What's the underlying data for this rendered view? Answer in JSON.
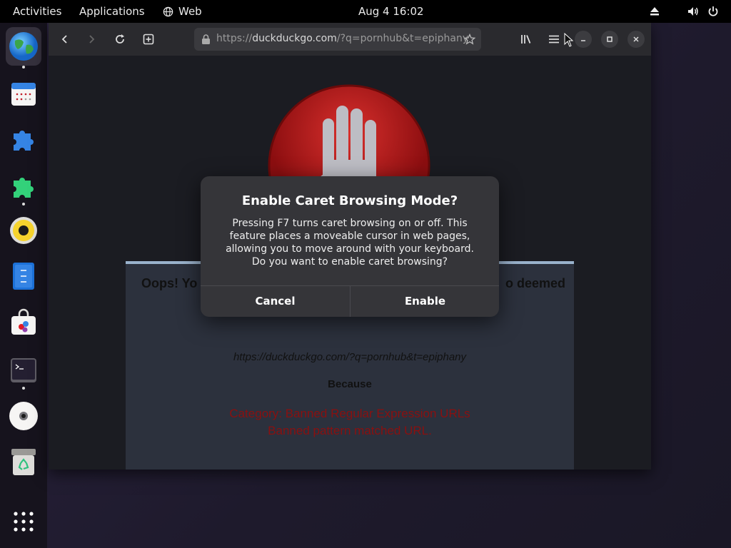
{
  "topbar": {
    "activities": "Activities",
    "applications": "Applications",
    "web": "Web",
    "clock": "Aug 4  16:02"
  },
  "dock": {
    "items": [
      {
        "name": "web-browser"
      },
      {
        "name": "calendar"
      },
      {
        "name": "extensions"
      },
      {
        "name": "extension-manager"
      },
      {
        "name": "rhythmbox"
      },
      {
        "name": "text-editor"
      },
      {
        "name": "software"
      },
      {
        "name": "terminal"
      },
      {
        "name": "disc"
      },
      {
        "name": "trash"
      },
      {
        "name": "app-grid"
      }
    ]
  },
  "browser": {
    "url_prefix": "https://",
    "url_host": "duckduckgo.com",
    "url_rest": "/?q=pornhub&t=epiphany"
  },
  "page": {
    "oops_left": "Oops! Yo",
    "oops_right": "o deemed",
    "blocked_url": "https://duckduckgo.com/?q=pornhub&t=epiphany",
    "because": "Because",
    "reason_line1": "Category: Banned Regular Expression URLs",
    "reason_line2": "Banned pattern matched URL."
  },
  "dialog": {
    "title": "Enable Caret Browsing Mode?",
    "body": "Pressing F7 turns caret browsing on or off. This feature places a moveable cursor in web pages, allowing you to move around with your keyboard. Do you want to enable caret browsing?",
    "cancel_label": "Cancel",
    "enable_label": "Enable"
  },
  "colors": {
    "accent_stop": "#b01b1b",
    "dialog_bg": "#353539",
    "reason_text": "#8a1010"
  }
}
